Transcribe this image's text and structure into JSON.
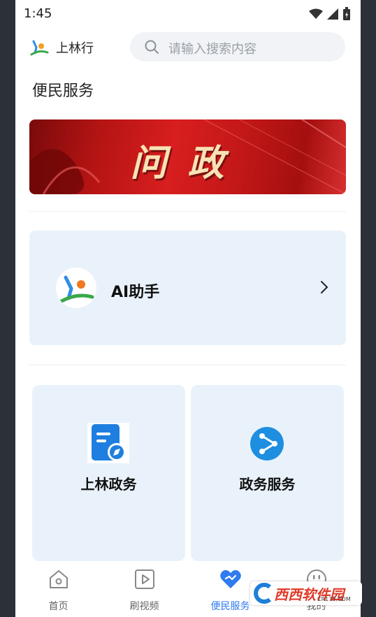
{
  "status_bar": {
    "time": "1:45"
  },
  "app": {
    "title": "上林行"
  },
  "search": {
    "placeholder": "请输入搜索内容"
  },
  "section": {
    "title": "便民服务"
  },
  "banner": {
    "text": "问政"
  },
  "ai_card": {
    "label": "AI助手"
  },
  "tiles": [
    {
      "label": "上林政务",
      "icon": "document-compass-icon"
    },
    {
      "label": "政务服务",
      "icon": "share-play-icon"
    }
  ],
  "tabs": [
    {
      "label": "首页",
      "icon": "home-icon",
      "active": false
    },
    {
      "label": "刷视频",
      "icon": "video-icon",
      "active": false
    },
    {
      "label": "便民服务",
      "icon": "heart-icon",
      "active": true
    },
    {
      "label": "我的",
      "icon": "face-icon",
      "active": false
    }
  ],
  "watermark": {
    "text": "西西软件园",
    "sub": "CR173.COM"
  },
  "colors": {
    "accent": "#2f7bef",
    "card_bg": "#e9f2fb",
    "banner_red": "#c41818"
  }
}
